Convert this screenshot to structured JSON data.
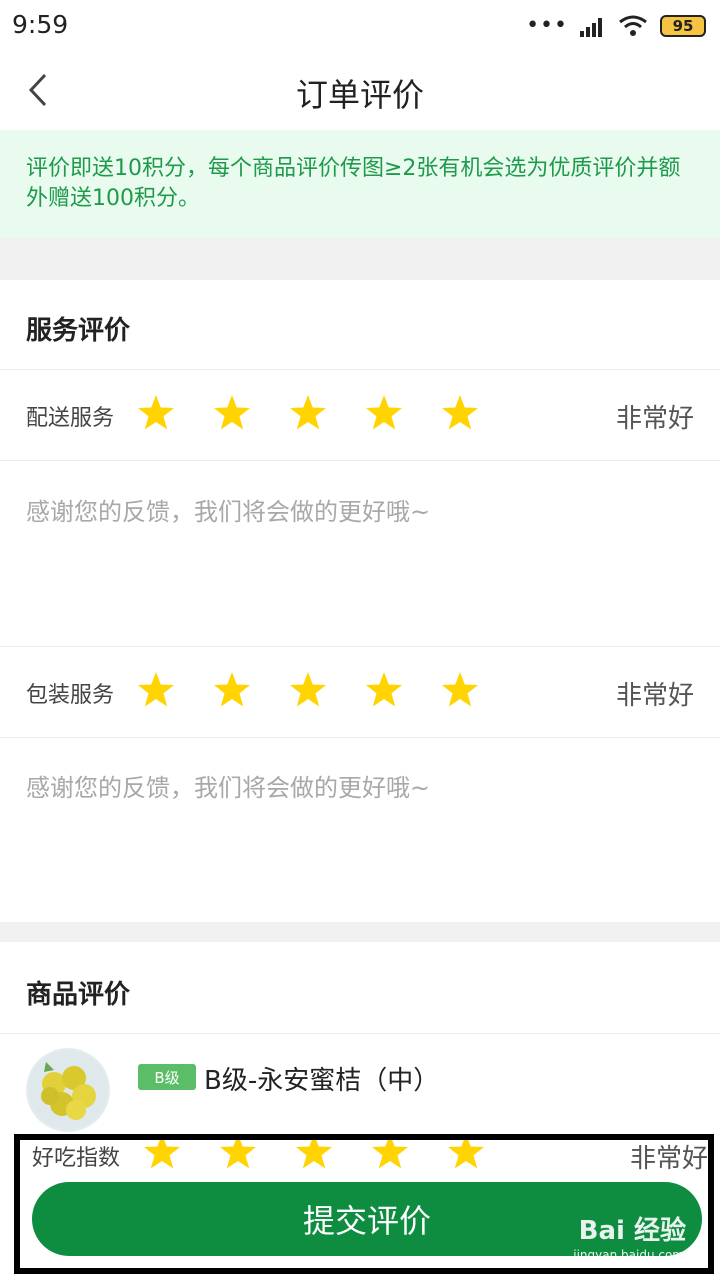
{
  "status_bar": {
    "time": "9:59",
    "battery": "95"
  },
  "header": {
    "title": "订单评价"
  },
  "notice": {
    "text": "评价即送10积分，每个商品评价传图≥2张有机会选为优质评价并额外赠送100积分。"
  },
  "service_section": {
    "title": "服务评价",
    "ratings": [
      {
        "label": "配送服务",
        "stars": 5,
        "value_text": "非常好",
        "feedback_placeholder": "感谢您的反馈，我们将会做的更好哦~"
      },
      {
        "label": "包装服务",
        "stars": 5,
        "value_text": "非常好",
        "feedback_placeholder": "感谢您的反馈，我们将会做的更好哦~"
      }
    ]
  },
  "product_section": {
    "title": "商品评价",
    "product": {
      "grade": "B级",
      "name": "B级-永安蜜桔（中）"
    },
    "rating": {
      "label": "好吃指数",
      "stars": 5,
      "value_text": "非常好"
    }
  },
  "footer": {
    "submit_label": "提交评价",
    "watermark": "Bai 经验",
    "watermark_url": "jingyan.baidu.com"
  },
  "colors": {
    "accent": "#0e8c40",
    "star": "#ffd400",
    "notice_bg": "#e9fbef",
    "notice_text": "#1f9a4a"
  }
}
